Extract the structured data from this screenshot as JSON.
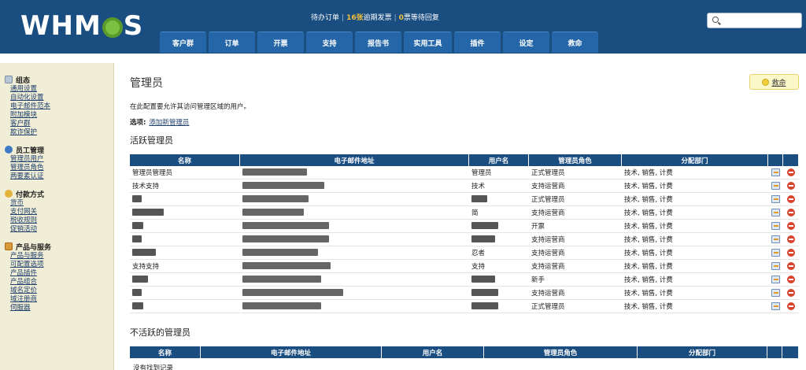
{
  "header": {
    "logo_text_1": "WHM",
    "logo_text_2": "S",
    "status": {
      "pending_orders": "待办订单",
      "overdue_count": "16张",
      "overdue_label": "逾期发票",
      "ticket_count": "0",
      "ticket_label": "票等待回复"
    },
    "search": {
      "placeholder": ""
    },
    "nav": [
      "客户群",
      "订单",
      "开票",
      "支持",
      "报告书",
      "实用工具",
      "插件",
      "设定",
      "救命"
    ]
  },
  "sidebar": {
    "sections": [
      {
        "title": "组态",
        "icon": "config-icon",
        "items": [
          "通用设置",
          "自动化设置",
          "电子邮件范本",
          "附加模块",
          "客户群",
          "欺诈保护"
        ]
      },
      {
        "title": "员工管理",
        "icon": "staff-icon",
        "items": [
          "管理员用户",
          "管理员角色",
          "两要素认证"
        ]
      },
      {
        "title": "付款方式",
        "icon": "payment-icon",
        "items": [
          "货币",
          "支付网关",
          "税收规则",
          "促销活动"
        ]
      },
      {
        "title": "产品与服务",
        "icon": "products-icon",
        "items": [
          "产品与服务",
          "可配置选项",
          "产品插件",
          "产品组合",
          "域名定价",
          "域注册商",
          "伺服器"
        ]
      }
    ]
  },
  "main": {
    "title": "管理员",
    "help_label": "救命",
    "description": "在此配置要允许其访问管理区域的用户。",
    "options_label": "选项:",
    "add_new_label": "添加新管理员",
    "active_title": "活跃管理员",
    "inactive_title": "不活跃的管理员",
    "columns": [
      "名称",
      "电子邮件地址",
      "用户名",
      "管理员角色",
      "分配部门"
    ],
    "active_rows": [
      {
        "name": "管理员管理员",
        "username": "管理员",
        "role": "正式管理员",
        "depts": "技术, 销售, 计费"
      },
      {
        "name": "技术支持",
        "username": "技术",
        "role": "支持运营商",
        "depts": "技术, 销售, 计费"
      },
      {
        "name": "",
        "username": "",
        "role": "正式管理员",
        "depts": "技术, 销售, 计费"
      },
      {
        "name": "",
        "username": "简",
        "role": "支持运营商",
        "depts": "技术, 销售, 计费"
      },
      {
        "name": "",
        "username": "",
        "role": "开票",
        "depts": "技术, 销售, 计费"
      },
      {
        "name": "",
        "username": "",
        "role": "支持运营商",
        "depts": "技术, 销售, 计费"
      },
      {
        "name": "",
        "username": "忍者",
        "role": "支持运营商",
        "depts": "技术, 销售, 计费"
      },
      {
        "name": "支持支持",
        "username": "支持",
        "role": "支持运营商",
        "depts": "技术, 销售, 计费"
      },
      {
        "name": "",
        "username": "",
        "role": "新手",
        "depts": "技术, 销售, 计费"
      },
      {
        "name": "",
        "username": "",
        "role": "支持运营商",
        "depts": "技术, 销售, 计费"
      },
      {
        "name": "",
        "username": "",
        "role": "正式管理员",
        "depts": "技术, 销售, 计费"
      }
    ],
    "no_records": "没有找到记录"
  },
  "colors": {
    "header_bg": "#1a4d80",
    "nav_tab": "#2466a8",
    "sidebar_bg": "#f0eed6",
    "accent": "#f3c13a"
  }
}
